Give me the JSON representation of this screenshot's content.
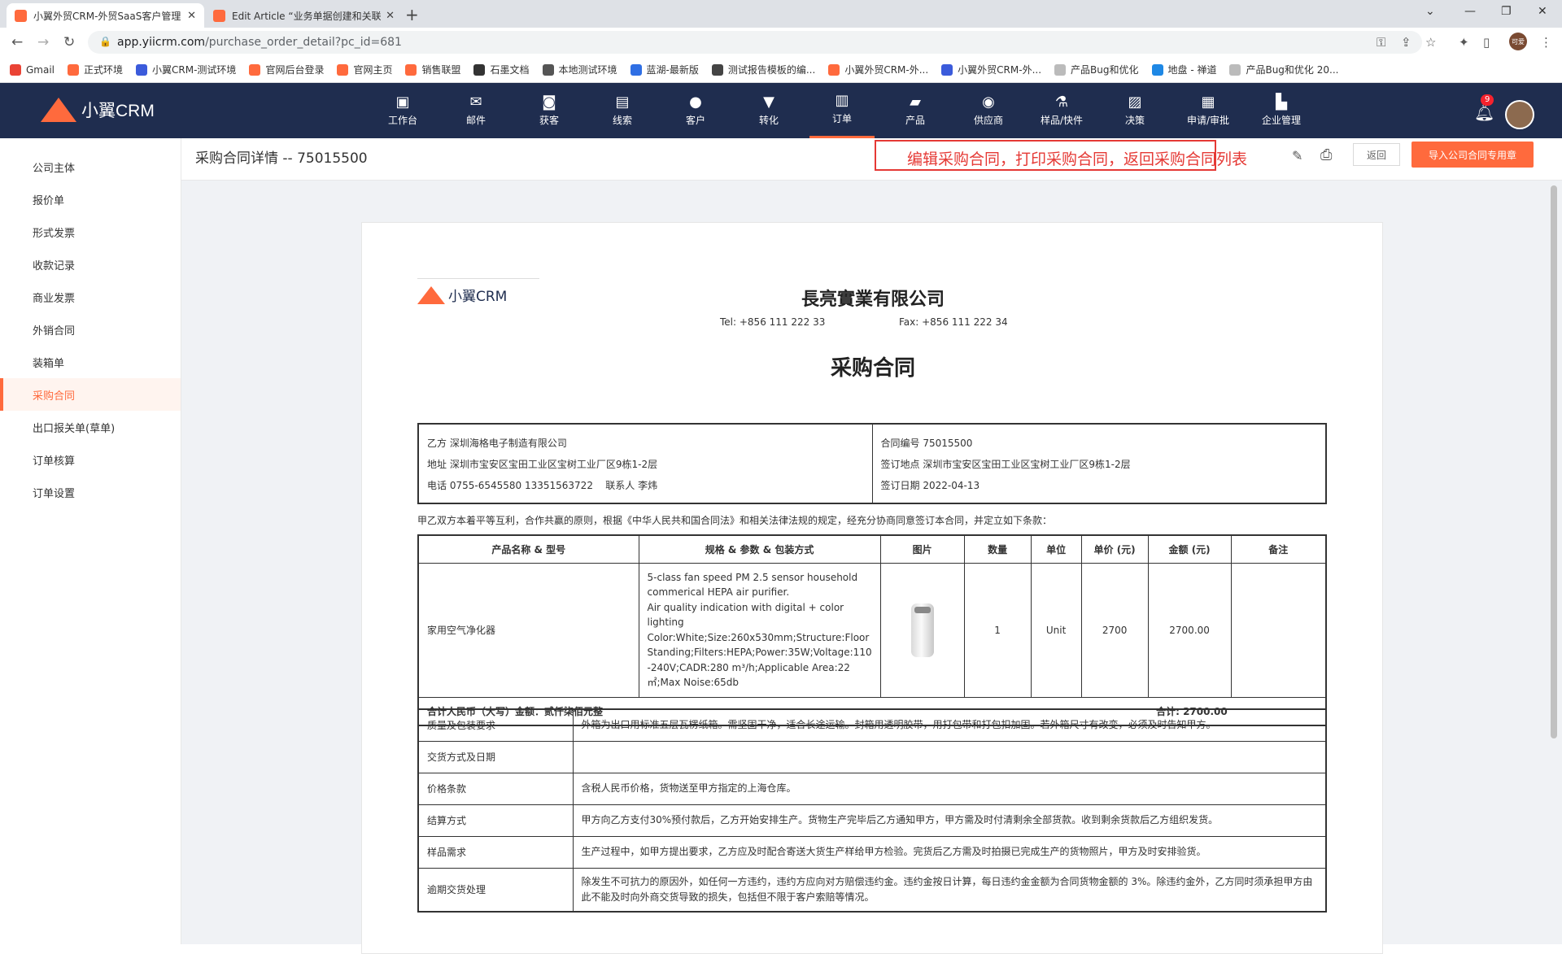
{
  "browser": {
    "tabs": [
      {
        "title": "小翼外贸CRM-外贸SaaS客户管理",
        "active": true
      },
      {
        "title": "Edit Article “业务单据创建和关联",
        "active": false
      }
    ],
    "url_host": "app.yiicrm.com",
    "url_path": "/purchase_order_detail?pc_id=681",
    "profile_initials": "可爱",
    "bookmarks": [
      {
        "label": "Gmail",
        "color": "#ea4335"
      },
      {
        "label": "正式环境",
        "color": "#ff6a3d"
      },
      {
        "label": "小翼CRM-测试环境",
        "color": "#3b5bdb"
      },
      {
        "label": "官网后台登录",
        "color": "#ff6a3d"
      },
      {
        "label": "官网主页",
        "color": "#ff6a3d"
      },
      {
        "label": "销售联盟",
        "color": "#ff6a3d"
      },
      {
        "label": "石墨文档",
        "color": "#333333"
      },
      {
        "label": "本地测试环境",
        "color": "#555555"
      },
      {
        "label": "蓝湖-最新版",
        "color": "#2f6fe4"
      },
      {
        "label": "测试报告模板的编...",
        "color": "#444444"
      },
      {
        "label": "小翼外贸CRM-外...",
        "color": "#ff6a3d"
      },
      {
        "label": "小翼外贸CRM-外...",
        "color": "#3b5bdb"
      },
      {
        "label": "产品Bug和优化",
        "color": "#bbbbbb"
      },
      {
        "label": "地盘 - 禅道",
        "color": "#1e88e5"
      },
      {
        "label": "产品Bug和优化 20...",
        "color": "#bbbbbb"
      }
    ]
  },
  "app": {
    "brand": "小翼CRM",
    "nav": [
      {
        "label": "工作台",
        "icon": "desk-icon",
        "glyph": "▣"
      },
      {
        "label": "邮件",
        "icon": "mail-icon",
        "glyph": "✉"
      },
      {
        "label": "获客",
        "icon": "acquire-icon",
        "glyph": "◙"
      },
      {
        "label": "线索",
        "icon": "lead-icon",
        "glyph": "▤"
      },
      {
        "label": "客户",
        "icon": "customer-icon",
        "glyph": "●"
      },
      {
        "label": "转化",
        "icon": "funnel-icon",
        "glyph": "▼"
      },
      {
        "label": "订单",
        "icon": "order-icon",
        "glyph": "▥",
        "active": true
      },
      {
        "label": "产品",
        "icon": "product-icon",
        "glyph": "▰"
      },
      {
        "label": "供应商",
        "icon": "supplier-icon",
        "glyph": "◉"
      },
      {
        "label": "样品/快件",
        "icon": "sample-icon",
        "glyph": "⚗"
      },
      {
        "label": "决策",
        "icon": "chart-icon",
        "glyph": "▨"
      },
      {
        "label": "申请/审批",
        "icon": "approval-icon",
        "glyph": "▦"
      },
      {
        "label": "企业管理",
        "icon": "enterprise-icon",
        "glyph": "▙"
      }
    ],
    "notification_count": "9"
  },
  "sidebar": {
    "items": [
      {
        "label": "公司主体"
      },
      {
        "label": "报价单"
      },
      {
        "label": "形式发票"
      },
      {
        "label": "收款记录"
      },
      {
        "label": "商业发票"
      },
      {
        "label": "外销合同"
      },
      {
        "label": "装箱单"
      },
      {
        "label": "采购合同",
        "active": true
      },
      {
        "label": "出口报关单(草单)"
      },
      {
        "label": "订单核算"
      },
      {
        "label": "订单设置"
      }
    ]
  },
  "header": {
    "title": "采购合同详情 -- 75015500",
    "annotation": "编辑采购合同，打印采购合同，返回采购合同列表",
    "back_label": "返回",
    "import_label": "导入公司合同专用章"
  },
  "doc": {
    "logo_text": "小翼CRM",
    "company": "長亮實業有限公司",
    "tel": "Tel: +856 111 222 33",
    "fax": "Fax: +856 111 222 34",
    "title": "采购合同",
    "party_b": {
      "name_label": "乙方",
      "name": "深圳海格电子制造有限公司",
      "addr_label": "地址",
      "addr": "深圳市宝安区宝田工业区宝树工业厂区9栋1-2层",
      "phone_label": "电话",
      "phone": "0755-6545580 13351563722",
      "contact_label": "联系人",
      "contact": "李炜"
    },
    "contract": {
      "no_label": "合同编号",
      "no": "75015500",
      "place_label": "签订地点",
      "place": "深圳市宝安区宝田工业区宝树工业厂区9栋1-2层",
      "date_label": "签订日期",
      "date": "2022-04-13"
    },
    "intro": "甲乙双方本着平等互利，合作共赢的原则，根据《中华人民共和国合同法》和相关法律法规的规定，经充分协商同意签订本合同，并定立如下条款：",
    "columns": [
      "产品名称 & 型号",
      "规格 & 参数 & 包装方式",
      "图片",
      "数量",
      "单位",
      "单价 (元)",
      "金额 (元)",
      "备注"
    ],
    "row": {
      "name": "家用空气净化器",
      "spec_lines": [
        "5-class fan speed PM 2.5 sensor household",
        "commerical HEPA air purifier.",
        "Air quality indication with digital + color",
        "lighting",
        "Color:White;Size:260x530mm;Structure:Floor",
        "Standing;Filters:HEPA;Power:35W;Voltage:110",
        "-240V;CADR:280 m³/h;Applicable Area:22",
        "㎡;Max Noise:65db"
      ],
      "qty": "1",
      "unit": "Unit",
      "price": "2700",
      "amount": "2700.00",
      "remark": ""
    },
    "total_words": "合计人民币（大写）金额：贰仟柒佰元整",
    "total_sum": "合计: 2700.00",
    "terms": [
      {
        "k": "质量及包装要求",
        "v": "外箱为出口用标准五层瓦楞纸箱。需坚固干净，适合长途运输。封箱用透明胶带，用打包带和打包扣加固。若外箱尺寸有改变，必须及时告知甲方。"
      },
      {
        "k": "交货方式及日期",
        "v": ""
      },
      {
        "k": "价格条款",
        "v": "含税人民币价格，货物送至甲方指定的上海仓库。"
      },
      {
        "k": "结算方式",
        "v": "甲方向乙方支付30%预付款后，乙方开始安排生产。货物生产完毕后乙方通知甲方，甲方需及时付清剩余全部货款。收到剩余货款后乙方组织发货。"
      },
      {
        "k": "样品需求",
        "v": "生产过程中，如甲方提出要求，乙方应及时配合寄送大货生产样给甲方检验。完货后乙方需及时拍摄已完成生产的货物照片，甲方及时安排验货。"
      },
      {
        "k": "逾期交货处理",
        "v": "除发生不可抗力的原因外，如任何一方违约，违约方应向对方赔偿违约金。违约金按日计算，每日违约金金额为合同货物金额的 3%。除违约金外，乙方同时须承担甲方由此不能及时向外商交货导致的损失，包括但不限于客户索赔等情况。"
      }
    ]
  }
}
